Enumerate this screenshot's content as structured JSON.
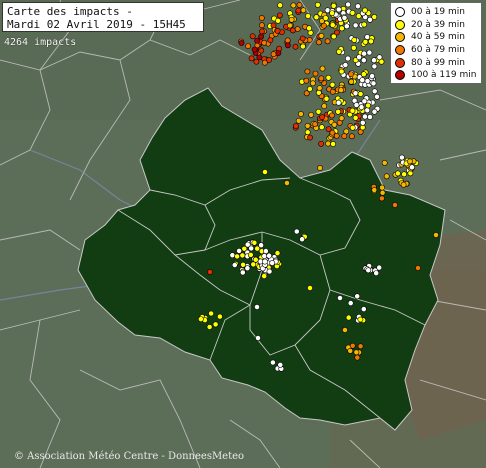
{
  "title": {
    "line1": "Carte des impacts -",
    "line2": "Mardi 02 Avril 2019 - 15H45"
  },
  "impacts_count": "4264 impacts",
  "legend": [
    {
      "label": "00 à 19 min",
      "color": "#ffffff"
    },
    {
      "label": "20 à 39 min",
      "color": "#ffff00"
    },
    {
      "label": "40 à 59 min",
      "color": "#f5b800"
    },
    {
      "label": "60 à 79 min",
      "color": "#f07800"
    },
    {
      "label": "80 à 99 min",
      "color": "#e03000"
    },
    {
      "label": "100 à 119 min",
      "color": "#b00000"
    }
  ],
  "credit": "© Association Météo Centre - DonneesMeteo",
  "colors": {
    "background_terrain": "#5d6e58",
    "region_fill": "#123d12",
    "borders": "#c8c8c8"
  }
}
